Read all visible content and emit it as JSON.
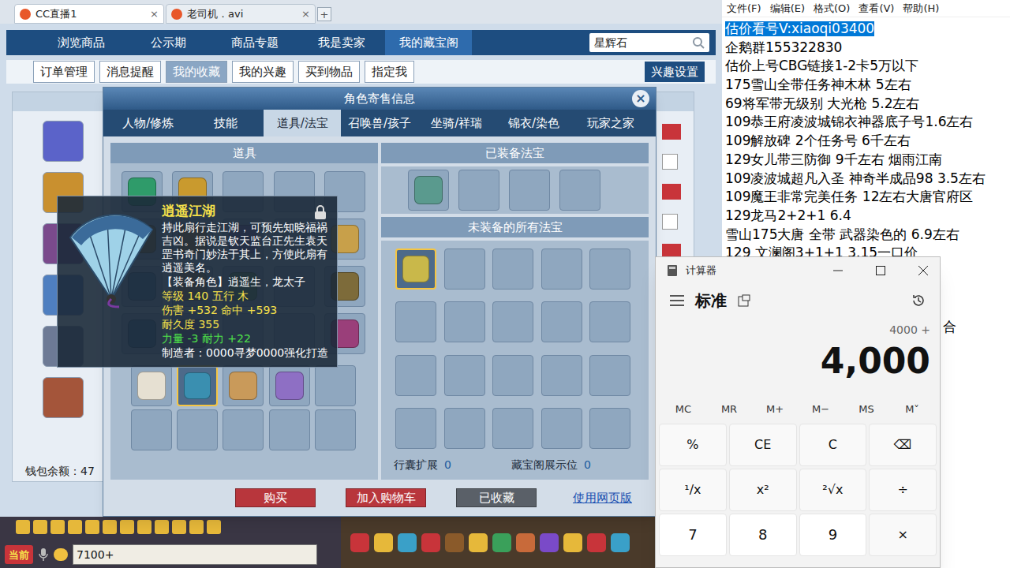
{
  "browser_tabs": [
    {
      "label": "CC直播1",
      "selected": true,
      "close": "×"
    },
    {
      "label": "老司机．avi",
      "selected": false,
      "close": "×"
    }
  ],
  "new_tab": "+",
  "cbg": {
    "nav": [
      {
        "label": "浏览商品",
        "selected": false
      },
      {
        "label": "公示期",
        "selected": false
      },
      {
        "label": "商品专题",
        "selected": false
      },
      {
        "label": "我是卖家",
        "selected": false
      },
      {
        "label": "我的藏宝阁",
        "selected": true
      }
    ],
    "search": {
      "value": "星辉石"
    },
    "subnav": [
      {
        "label": "订单管理",
        "selected": false
      },
      {
        "label": "消息提醒",
        "selected": false
      },
      {
        "label": "我的收藏",
        "selected": true
      },
      {
        "label": "我的兴趣",
        "selected": false
      },
      {
        "label": "买到物品",
        "selected": false
      },
      {
        "label": "指定我",
        "selected": false
      }
    ],
    "interest_button": "兴趣设置",
    "avatars": [
      {
        "color": "#5b63c9"
      },
      {
        "color": "#c9902f"
      },
      {
        "color": "#7a4a8c"
      },
      {
        "color": "#4f7fc0"
      },
      {
        "color": "#6d7a95"
      },
      {
        "color": "#a4553a"
      }
    ],
    "wallet": "钱包余额：47"
  },
  "modal": {
    "title": "角色寄售信息",
    "close": "×",
    "tabs": [
      {
        "label": "人物/修炼",
        "selected": false
      },
      {
        "label": "技能",
        "selected": false
      },
      {
        "label": "道具/法宝",
        "selected": true
      },
      {
        "label": "召唤兽/孩子",
        "selected": false
      },
      {
        "label": "坐骑/祥瑞",
        "selected": false
      },
      {
        "label": "锦衣/染色",
        "selected": false
      },
      {
        "label": "玩家之家",
        "selected": false
      }
    ],
    "items_header": "道具",
    "equipped_header": "已装备法宝",
    "unequipped_header": "未装备的所有法宝",
    "item_slots": [
      {
        "filled": true,
        "selected": false,
        "color": "#2f9b6a"
      },
      {
        "filled": true,
        "selected": false,
        "color": "#c99a2e"
      },
      {
        "filled": false,
        "selected": false
      },
      {
        "filled": false,
        "selected": false
      },
      {
        "filled": false,
        "selected": false
      },
      {
        "filled": true,
        "selected": false,
        "color": "#8a6d3b"
      },
      {
        "filled": true,
        "selected": false,
        "color": "#b0773a"
      },
      {
        "filled": true,
        "selected": false,
        "color": "#7c5aa8"
      },
      {
        "filled": false,
        "selected": false
      },
      {
        "filled": true,
        "selected": false,
        "color": "#c8a04a"
      },
      {
        "filled": true,
        "selected": false,
        "color": "#4d7aa6"
      },
      {
        "filled": true,
        "selected": false,
        "color": "#a07b4d"
      },
      {
        "filled": true,
        "selected": false,
        "color": "#5e8f4f"
      },
      {
        "filled": false,
        "selected": false
      },
      {
        "filled": true,
        "selected": false,
        "color": "#7d6b3a"
      },
      {
        "filled": true,
        "selected": false,
        "color": "#3f6f98"
      },
      {
        "filled": true,
        "selected": false,
        "color": "#6b5a8a"
      },
      {
        "filled": false,
        "selected": false
      },
      {
        "filled": false,
        "selected": false
      },
      {
        "filled": true,
        "selected": false,
        "color": "#9a3f7a"
      }
    ],
    "bag_slots": [
      {
        "filled": true,
        "selected": false,
        "color": "#e6e0d2"
      },
      {
        "filled": true,
        "selected": true,
        "color": "#3a8fb0"
      },
      {
        "filled": true,
        "selected": false,
        "color": "#c99a5a"
      },
      {
        "filled": true,
        "selected": false,
        "color": "#8e6fc4"
      },
      {
        "filled": false,
        "selected": false
      },
      {
        "filled": false,
        "selected": false
      },
      {
        "filled": false,
        "selected": false
      },
      {
        "filled": false,
        "selected": false
      },
      {
        "filled": false,
        "selected": false
      },
      {
        "filled": false,
        "selected": false
      }
    ],
    "equipped_slots": [
      {
        "filled": true,
        "selected": false,
        "color": "#5a9a8e"
      },
      {
        "filled": false,
        "selected": false
      },
      {
        "filled": false,
        "selected": false
      },
      {
        "filled": false,
        "selected": false
      }
    ],
    "unequipped_slots": [
      {
        "filled": true,
        "selected": true,
        "color": "#c9b84a"
      },
      {
        "filled": false,
        "selected": false
      },
      {
        "filled": false,
        "selected": false
      },
      {
        "filled": false,
        "selected": false
      },
      {
        "filled": false,
        "selected": false
      },
      {
        "filled": false,
        "selected": false
      },
      {
        "filled": false,
        "selected": false
      },
      {
        "filled": false,
        "selected": false
      },
      {
        "filled": false,
        "selected": false
      },
      {
        "filled": false,
        "selected": false
      },
      {
        "filled": false,
        "selected": false
      },
      {
        "filled": false,
        "selected": false
      },
      {
        "filled": false,
        "selected": false
      },
      {
        "filled": false,
        "selected": false
      },
      {
        "filled": false,
        "selected": false
      },
      {
        "filled": false,
        "selected": false
      },
      {
        "filled": false,
        "selected": false
      },
      {
        "filled": false,
        "selected": false
      },
      {
        "filled": false,
        "selected": false
      },
      {
        "filled": false,
        "selected": false
      }
    ],
    "expand_label": "行囊扩展",
    "expand_value": "0",
    "showcase_label": "藏宝阁展示位",
    "showcase_value": "0",
    "buttons": [
      {
        "label": "购买",
        "kind": "red"
      },
      {
        "label": "加入购物车",
        "kind": "red"
      },
      {
        "label": "已收藏",
        "kind": "gray"
      }
    ],
    "web_link": "使用网页版"
  },
  "tooltip": {
    "title": "逍遥江湖",
    "description": "持此扇行走江湖，可预先知晓福祸吉凶。据说是钦天监台正先生袁天罡书奇门妙法于其上，方使此扇有逍遥美名。",
    "lines": [
      {
        "text": "【装备角色】逍遥生，龙太子",
        "color": "#ffffff"
      },
      {
        "text": "等级 140  五行 木",
        "color": "#f5e04a"
      },
      {
        "text": "伤害 +532  命中 +593",
        "color": "#f5e04a"
      },
      {
        "text": "耐久度 355",
        "color": "#f5e04a"
      },
      {
        "text": "力量 -3  耐力 +22",
        "color": "#4ee04a"
      },
      {
        "text": "制造者：0000寻梦0000强化打造",
        "color": "#ffffff"
      }
    ]
  },
  "game_bar": {
    "channel": "当前",
    "input": "7100+"
  },
  "notepad": {
    "menu": [
      "文件(F)",
      "编辑(E)",
      "格式(O)",
      "查看(V)",
      "帮助(H)"
    ],
    "lines": [
      {
        "text": "估价看号V:xiaoqi03400",
        "selected": true,
        "kind": "line"
      },
      {
        "text": "企鹅群155322830",
        "selected": false,
        "kind": "line"
      },
      {
        "text": "估价上号CBG链接1-2卡5万以下",
        "selected": false,
        "kind": "line"
      },
      {
        "text": "175雪山全带任务神木林 5左右",
        "selected": false,
        "kind": "line"
      },
      {
        "text": "69将军带无级别 大光枪 5.2左右",
        "selected": false,
        "kind": "line"
      },
      {
        "text": "109恭王府凌波城锦衣神器底子号1.6左右",
        "selected": false,
        "kind": "line"
      },
      {
        "text": "109解放碑 2个任务号 6千左右",
        "selected": false,
        "kind": "line"
      },
      {
        "text": "129女儿带三防御 9千左右 烟雨江南",
        "selected": false,
        "kind": "line"
      },
      {
        "text": "109凌波城超凡入圣 神奇半成品98 3.5左右",
        "selected": false,
        "kind": "line"
      },
      {
        "text": "109魔王非常完美任务 12左右大唐官府区",
        "selected": false,
        "kind": "line"
      },
      {
        "text": "129龙马2+2+1  6.4",
        "selected": false,
        "kind": "line"
      },
      {
        "text": "雪山175大唐 全带 武器染色的 6.9左右",
        "selected": false,
        "kind": "line"
      },
      {
        "text": "129 文澜阁3+1+1  3.15一口价",
        "selected": false,
        "kind": "line"
      },
      {
        "text": "合",
        "selected": false,
        "kind": "fragment"
      }
    ]
  },
  "calculator": {
    "title": "计算器",
    "mode": "标准",
    "expression": "4000 +",
    "display": "4,000",
    "memory": [
      "MC",
      "MR",
      "M+",
      "M−",
      "MS",
      "M˅"
    ],
    "buttons": [
      {
        "label": "%",
        "kind": "op"
      },
      {
        "label": "CE",
        "kind": "op"
      },
      {
        "label": "C",
        "kind": "op"
      },
      {
        "label": "⌫",
        "kind": "op"
      },
      {
        "label": "¹/x",
        "kind": "op"
      },
      {
        "label": "x²",
        "kind": "op"
      },
      {
        "label": "²√x",
        "kind": "op"
      },
      {
        "label": "÷",
        "kind": "op"
      },
      {
        "label": "7",
        "kind": "digit"
      },
      {
        "label": "8",
        "kind": "digit"
      },
      {
        "label": "9",
        "kind": "digit"
      },
      {
        "label": "×",
        "kind": "op"
      }
    ]
  }
}
